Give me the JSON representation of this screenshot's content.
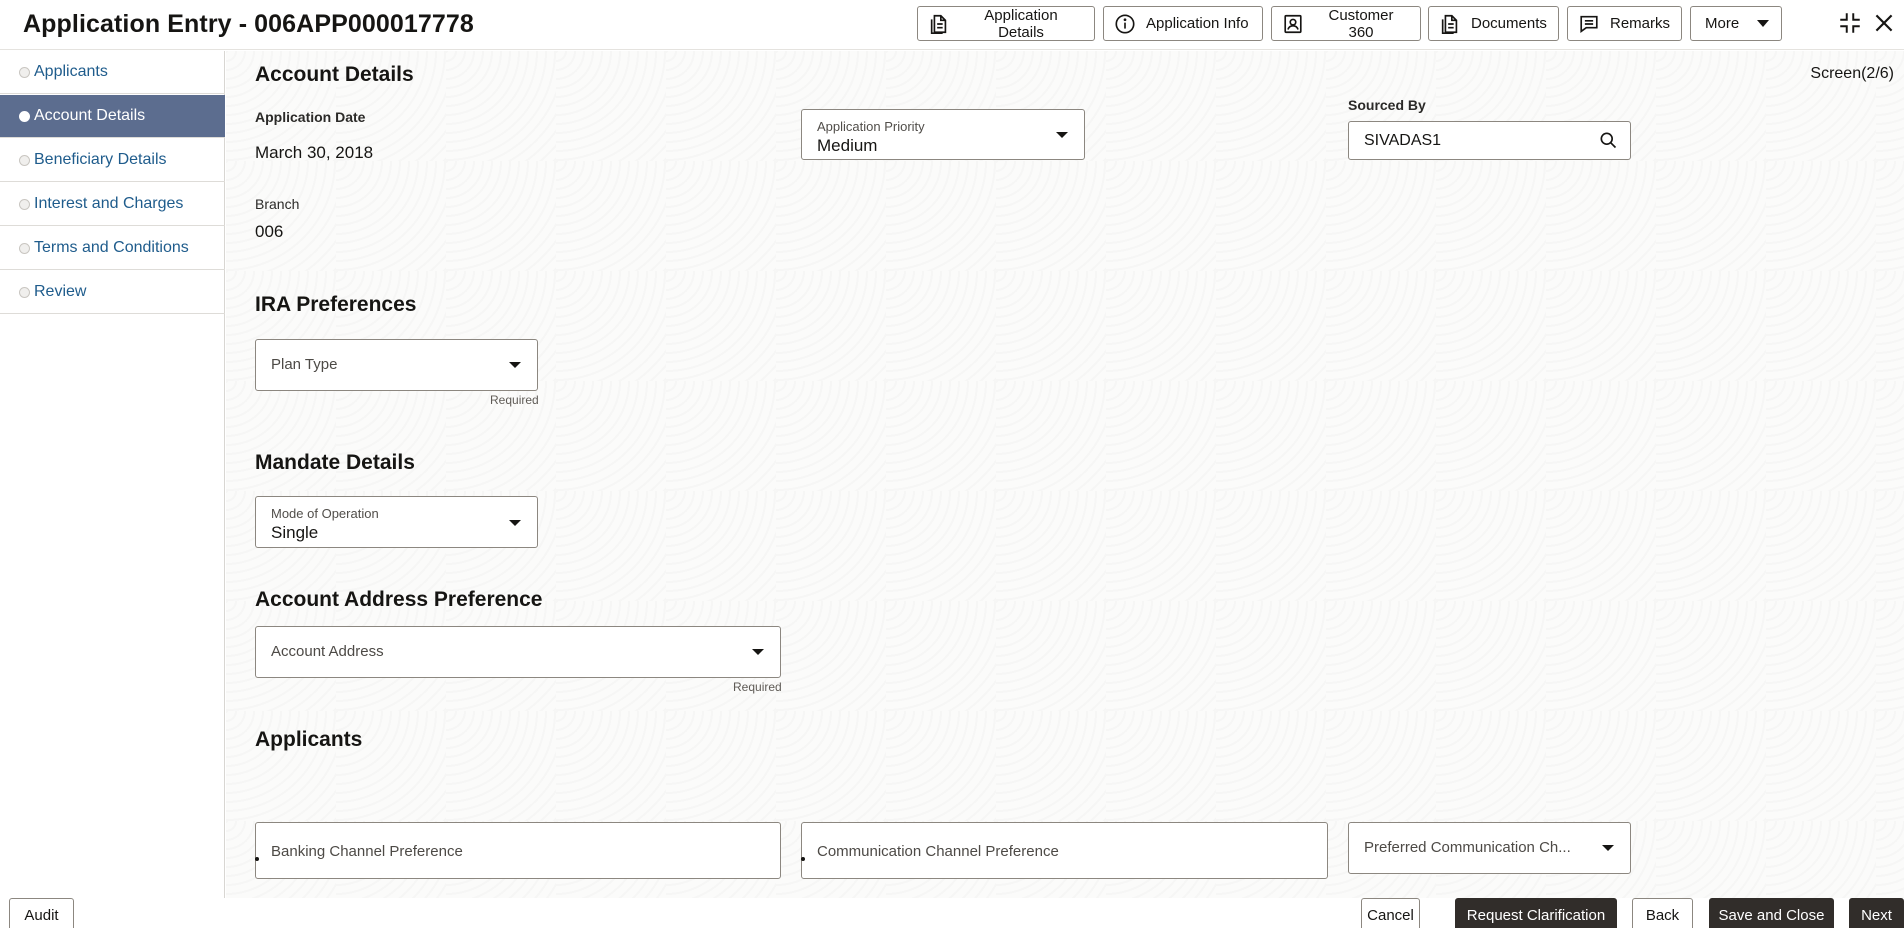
{
  "header": {
    "title": "Application Entry - 006APP000017778",
    "buttons": {
      "application_details": "Application Details",
      "application_info": "Application Info",
      "customer_360": "Customer 360",
      "documents": "Documents",
      "remarks": "Remarks",
      "more": "More"
    }
  },
  "sidebar": {
    "items": [
      {
        "label": "Applicants"
      },
      {
        "label": "Account Details"
      },
      {
        "label": "Beneficiary Details"
      },
      {
        "label": "Interest and Charges"
      },
      {
        "label": "Terms and Conditions"
      },
      {
        "label": "Review"
      }
    ],
    "active": "Account Details"
  },
  "main": {
    "screen_counter": "Screen(2/6)",
    "account_details": {
      "title": "Account Details",
      "application_date_label": "Application Date",
      "application_date_value": "March 30, 2018",
      "application_priority_label": "Application Priority",
      "application_priority_value": "Medium",
      "sourced_by_label": "Sourced By",
      "sourced_by_value": "SIVADAS1",
      "branch_label": "Branch",
      "branch_value": "006"
    },
    "ira_preferences": {
      "title": "IRA Preferences",
      "plan_type_placeholder": "Plan Type",
      "required": "Required"
    },
    "mandate_details": {
      "title": "Mandate Details",
      "mode_label": "Mode of Operation",
      "mode_value": "Single"
    },
    "account_address_preference": {
      "title": "Account Address Preference",
      "account_address_placeholder": "Account Address",
      "required": "Required"
    },
    "applicants": {
      "title": "Applicants",
      "banking_channel_preference": "Banking Channel Preference",
      "communication_channel_preference": "Communication Channel Preference",
      "preferred_communication_channel": "Preferred Communication Ch..."
    }
  },
  "footer": {
    "audit": "Audit",
    "cancel": "Cancel",
    "request_clarification": "Request Clarification",
    "back": "Back",
    "save_and_close": "Save and Close",
    "next": "Next"
  }
}
